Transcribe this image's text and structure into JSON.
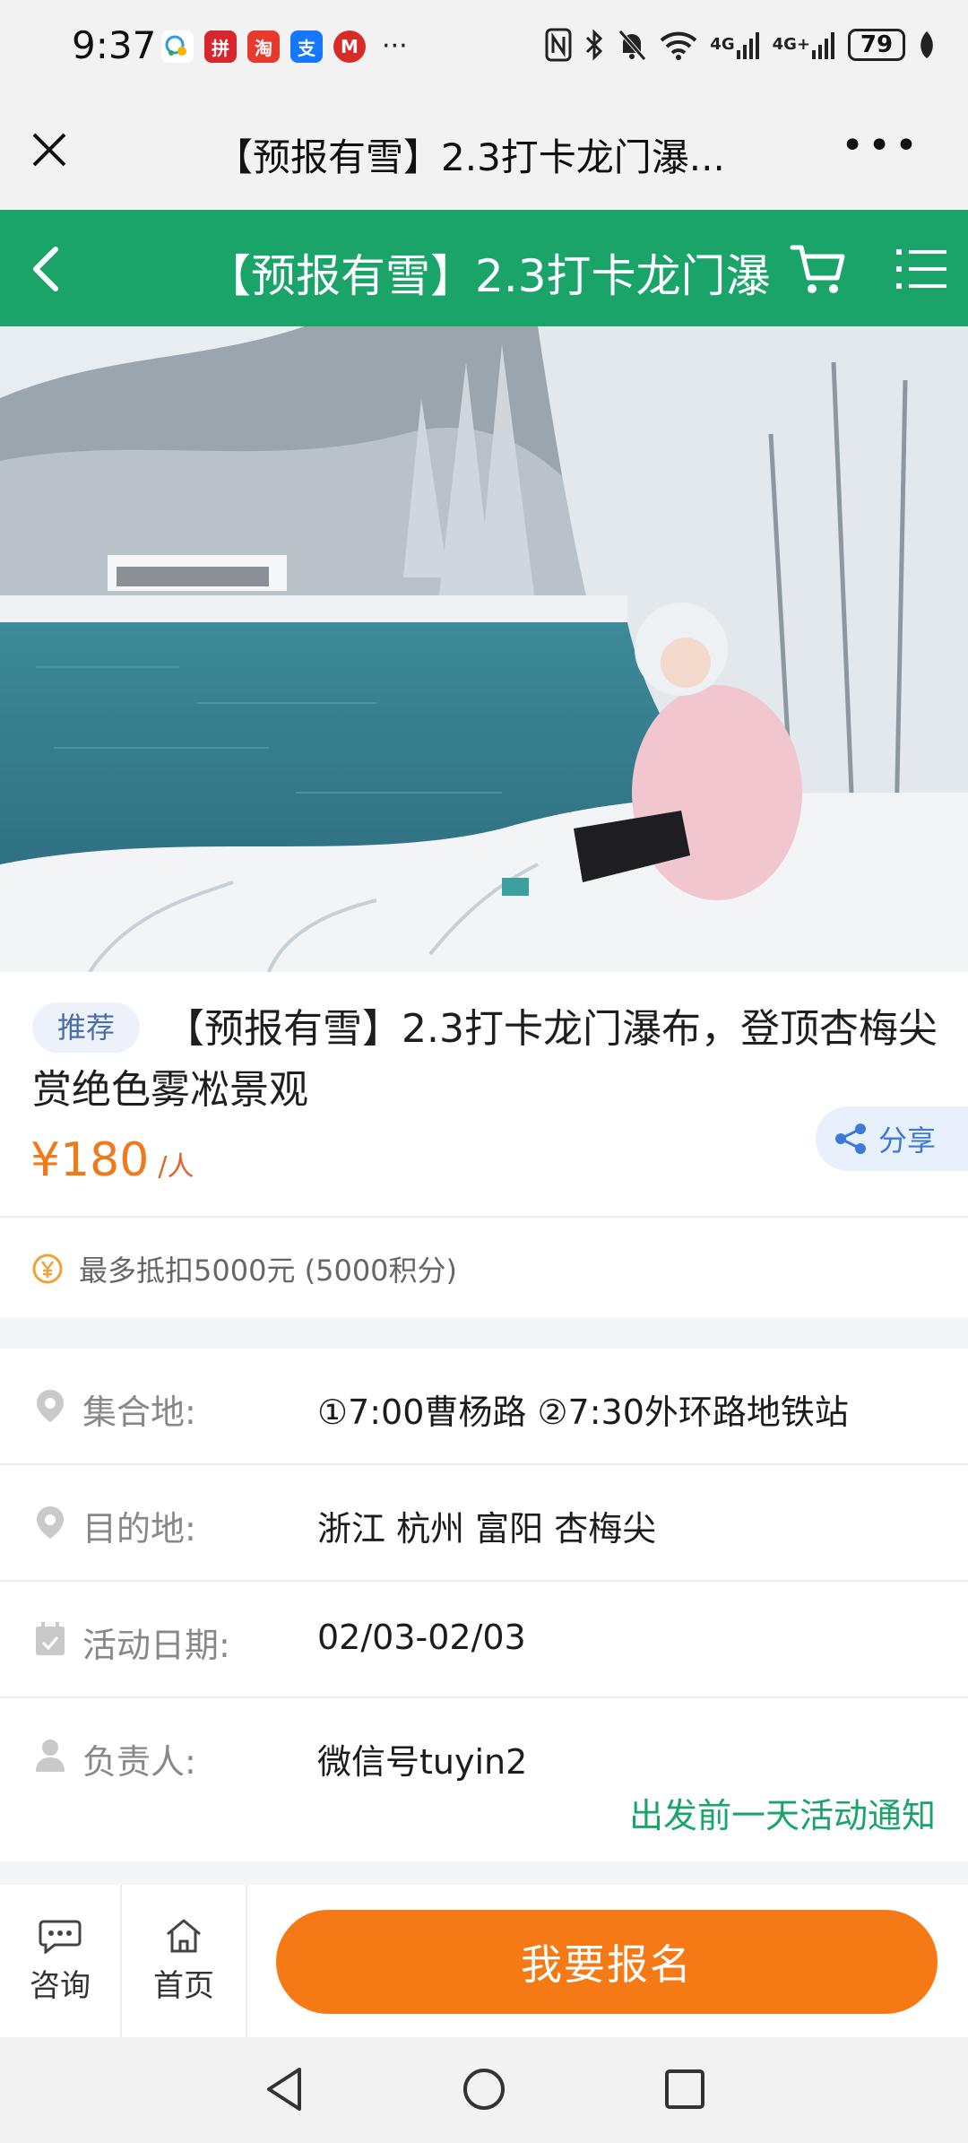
{
  "status_bar": {
    "time": "9:37",
    "apps": [
      {
        "icon": "wechat-work-icon",
        "color": "#ffffff",
        "label": ""
      },
      {
        "icon": "news-app-icon",
        "color": "#d8262e",
        "label": "拼"
      },
      {
        "icon": "shopping-app-icon",
        "color": "#e8392e",
        "label": "淘"
      },
      {
        "icon": "alipay-icon",
        "color": "#1677ff",
        "label": "支"
      },
      {
        "icon": "metro-app-icon",
        "color": "#d82a26",
        "label": "M"
      }
    ],
    "more": "···",
    "network_1": "4G",
    "network_2": "4G+",
    "battery": "79"
  },
  "mini_header": {
    "title": "【预报有雪】2.3打卡龙门瀑..."
  },
  "nav": {
    "title": "【预报有雪】2.3打卡龙门瀑",
    "accent_color": "#1aa46a"
  },
  "product": {
    "badge": "推荐",
    "title": "【预报有雪】2.3打卡龙门瀑布，登顶杏梅尖赏绝色雾凇景观",
    "price": "¥180",
    "price_unit": "/人",
    "share_label": "分享",
    "points_text": "最多抵扣5000元 (5000积分)"
  },
  "info": [
    {
      "label": "集合地:",
      "value": "①7:00曹杨路 ②7:30外环路地铁站",
      "icon": "location-pin-icon"
    },
    {
      "label": "目的地:",
      "value": "浙江 杭州 富阳 杏梅尖",
      "icon": "location-pin-icon"
    },
    {
      "label": "活动日期:",
      "value": "02/03-02/03",
      "icon": "calendar-icon"
    },
    {
      "label": "负责人:",
      "value": "微信号tuyin2",
      "icon": "person-icon"
    }
  ],
  "notice": "出发前一天活动通知",
  "actions": {
    "consult": "咨询",
    "home": "首页",
    "signup": "我要报名"
  }
}
